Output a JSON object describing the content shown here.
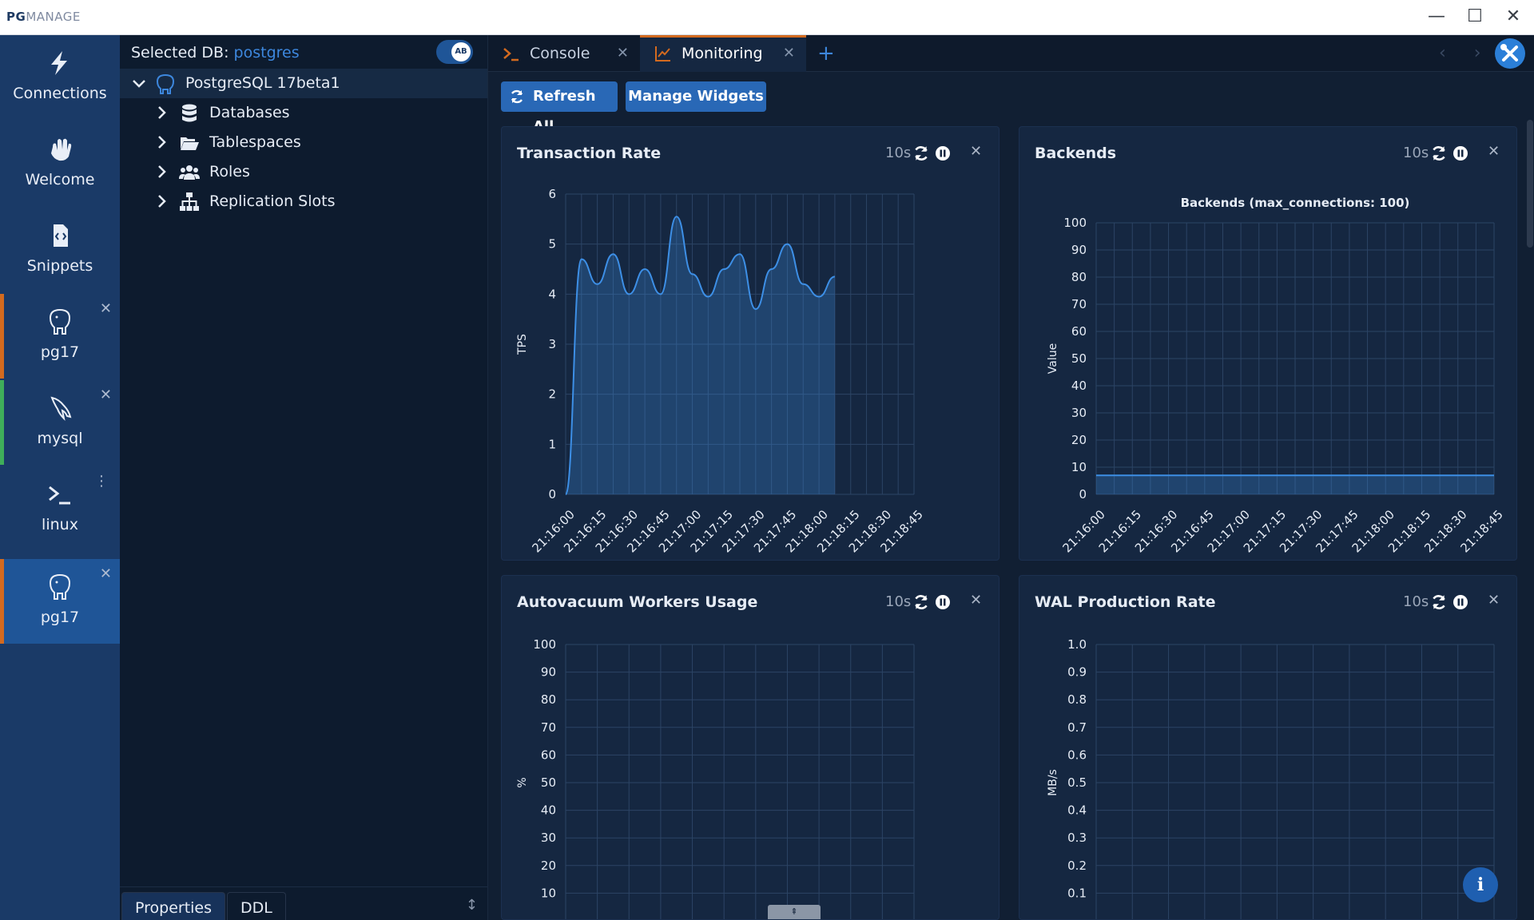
{
  "app": {
    "logo_pg": "PG",
    "logo_manage": "MANAGE"
  },
  "window": {
    "minimize": "—",
    "maximize": "☐",
    "close": "✕"
  },
  "rail": {
    "items": [
      {
        "label": "Connections",
        "icon": "bolt-icon"
      },
      {
        "label": "Welcome",
        "icon": "hand-wave-icon"
      },
      {
        "label": "Snippets",
        "icon": "code-file-icon"
      },
      {
        "label": "pg17",
        "icon": "postgres-elephant-icon",
        "accent": "#d36a1f",
        "close": "✕"
      },
      {
        "label": "mysql",
        "icon": "mysql-dolphin-icon",
        "accent": "#3fae5a",
        "close": "✕"
      },
      {
        "label": "linux",
        "icon": "terminal-icon",
        "menu": "⋮"
      },
      {
        "label": "pg17",
        "icon": "postgres-elephant-icon",
        "accent": "#d36a1f",
        "close": "✕",
        "active": true
      }
    ]
  },
  "tree": {
    "selected_prefix": "Selected DB:",
    "selected_db": "postgres",
    "toggle_label": "AB",
    "server": "PostgreSQL 17beta1",
    "nodes": [
      "Databases",
      "Tablespaces",
      "Roles",
      "Replication Slots"
    ],
    "footer_tabs": [
      "Properties",
      "DDL"
    ],
    "resize_glyph": "↕"
  },
  "tabs": [
    {
      "label": "Console",
      "close": "✕"
    },
    {
      "label": "Monitoring",
      "close": "✕"
    }
  ],
  "add_tab": "+",
  "nav_arrows": "‹ ›",
  "toolbar": {
    "refresh_all": "Refresh All",
    "manage_widgets": "Manage Widgets"
  },
  "widgets": {
    "transaction_rate": {
      "title": "Transaction Rate",
      "interval": "10s",
      "close": "✕"
    },
    "backends": {
      "title": "Backends",
      "interval": "10s",
      "close": "✕"
    },
    "autovacuum": {
      "title": "Autovacuum Workers Usage",
      "interval": "10s",
      "close": "✕"
    },
    "wal": {
      "title": "WAL Production Rate",
      "interval": "10s",
      "close": "✕"
    }
  },
  "info_glyph": "i",
  "bottom_handle_glyph": "⇞",
  "colors": {
    "accent_blue": "#3d87dd",
    "series": "#3d8fe6",
    "rail_bg": "#1a3a67",
    "active_tab_border": "#d36a1f"
  },
  "chart_data": [
    {
      "id": "transaction_rate",
      "type": "area",
      "title": "",
      "xlabel": "",
      "ylabel": "TPS",
      "x": [
        "21:16:00",
        "21:16:15",
        "21:16:30",
        "21:16:45",
        "21:17:00",
        "21:17:15",
        "21:17:30",
        "21:17:45",
        "21:18:00",
        "21:18:15",
        "21:18:30",
        "21:18:45"
      ],
      "ylim": [
        0,
        6
      ],
      "yticks": [
        0,
        1,
        2,
        3,
        4,
        5,
        6
      ],
      "series": [
        {
          "points": [
            [
              0,
              0
            ],
            [
              0.5,
              4.7
            ],
            [
              1,
              4.2
            ],
            [
              1.5,
              4.8
            ],
            [
              2,
              4.0
            ],
            [
              2.5,
              4.5
            ],
            [
              3,
              4.0
            ],
            [
              3.5,
              5.55
            ],
            [
              4,
              4.4
            ],
            [
              4.5,
              3.95
            ],
            [
              5,
              4.5
            ],
            [
              5.5,
              4.8
            ],
            [
              6,
              3.7
            ],
            [
              6.5,
              4.5
            ],
            [
              7,
              5.0
            ],
            [
              7.5,
              4.2
            ],
            [
              8,
              3.95
            ],
            [
              8.5,
              4.35
            ]
          ]
        }
      ],
      "grid": true
    },
    {
      "id": "backends",
      "type": "area",
      "title": "Backends (max_connections: 100)",
      "xlabel": "",
      "ylabel": "Value",
      "x": [
        "21:16:00",
        "21:16:15",
        "21:16:30",
        "21:16:45",
        "21:17:00",
        "21:17:15",
        "21:17:30",
        "21:17:45",
        "21:18:00",
        "21:18:15",
        "21:18:30",
        "21:18:45"
      ],
      "ylim": [
        0,
        100
      ],
      "yticks": [
        0,
        10,
        20,
        30,
        40,
        50,
        60,
        70,
        80,
        90,
        100
      ],
      "series": [
        {
          "points": [
            [
              0,
              7
            ],
            [
              11,
              7
            ]
          ]
        }
      ],
      "grid": true
    },
    {
      "id": "autovacuum",
      "type": "line",
      "title": "",
      "xlabel": "",
      "ylabel": "%",
      "ylim": [
        0,
        100
      ],
      "yticks": [
        10,
        20,
        30,
        40,
        50,
        60,
        70,
        80,
        90,
        100
      ],
      "series": [],
      "grid": true
    },
    {
      "id": "wal",
      "type": "line",
      "title": "",
      "xlabel": "",
      "ylabel": "MB/s",
      "ylim": [
        0,
        1.0
      ],
      "yticks": [
        "0.1",
        "0.2",
        "0.3",
        "0.4",
        "0.5",
        "0.6",
        "0.7",
        "0.8",
        "0.9",
        "1.0"
      ],
      "series": [],
      "grid": true
    }
  ]
}
